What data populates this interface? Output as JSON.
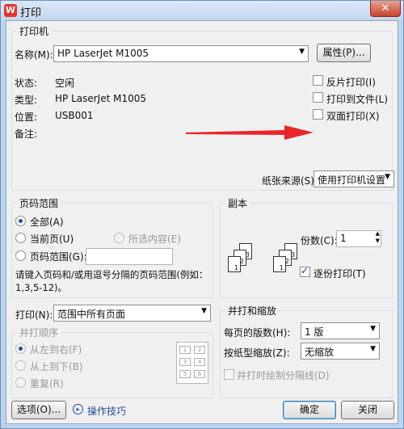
{
  "window": {
    "title": "打印",
    "close": "✕"
  },
  "printer": {
    "group_title": "打印机",
    "name_label": "名称(M):",
    "name_value": "HP LaserJet M1005",
    "properties_button": "属性(P)...",
    "status_label": "状态:",
    "status_value": "空闲",
    "type_label": "类型:",
    "type_value": "HP LaserJet M1005",
    "location_label": "位置:",
    "location_value": "USB001",
    "comment_label": "备注:",
    "reverse_print": "反片打印(I)",
    "print_to_file": "打印到文件(L)",
    "duplex_print": "双面打印(X)",
    "paper_source_label": "纸张来源(S):",
    "paper_source_value": "使用打印机设置"
  },
  "page_range": {
    "group_title": "页码范围",
    "all": "全部(A)",
    "current": "当前页(U)",
    "selection": "所选内容(E)",
    "pages": "页码范围(G):",
    "pages_value": "",
    "hint_line1": "请键入页码和/或用逗号分隔的页码范围(例如：",
    "hint_line2": "1,3,5-12)。"
  },
  "copies": {
    "group_title": "副本",
    "count_label": "份数(C):",
    "count_value": "1",
    "collate": "逐份打印(T)",
    "icons": [
      "1",
      "2",
      "3",
      "1",
      "2",
      "3"
    ]
  },
  "print_what": {
    "label": "打印(N):",
    "value": "范围中所有页面"
  },
  "order": {
    "group_title": "并打顺序",
    "ltr": "从左到右(F)",
    "ttb": "从上到下(B)",
    "repeat": "重复(R)",
    "grid": [
      "1",
      "2",
      "3",
      "4",
      "5",
      "6"
    ]
  },
  "zoom": {
    "group_title": "并打和缩放",
    "per_sheet_label": "每页的版数(H):",
    "per_sheet_value": "1 版",
    "scale_label": "按纸型缩放(Z):",
    "scale_value": "无缩放",
    "draw_borders": "并打时绘制分隔线(D)"
  },
  "footer": {
    "options_button": "选项(O)...",
    "tips_link": "操作技巧",
    "ok_button": "确定",
    "cancel_button": "关闭"
  },
  "colors": {
    "accent": "#1f4e9a",
    "annotation": "#e8262b"
  }
}
